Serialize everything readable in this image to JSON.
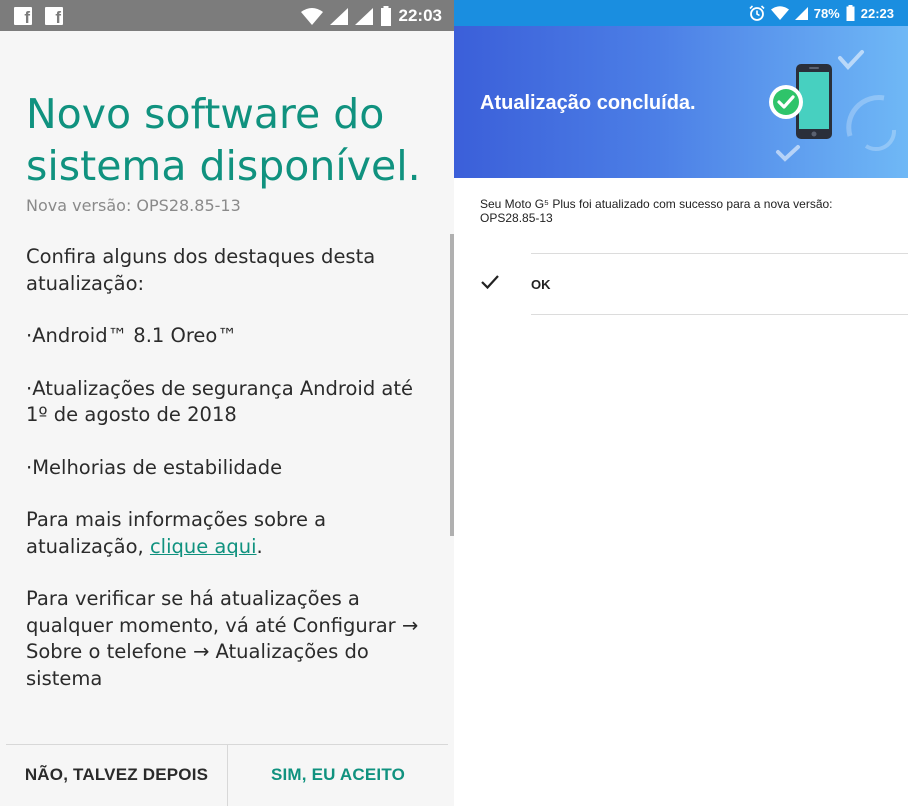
{
  "left_screen": {
    "status_bar": {
      "time": "22:03",
      "icons": [
        "facebook-icon",
        "facebook-icon",
        "wifi-icon",
        "signal-icon",
        "signal-icon",
        "battery-icon"
      ]
    },
    "title": "Novo software do sistema disponível.",
    "version": "Nova versão: OPS28.85-13",
    "intro": "Confira alguns dos destaques desta atualização:",
    "highlights": [
      "·Android™ 8.1 Oreo™",
      "·Atualizações de segurança Android até 1º de agosto de 2018",
      "·Melhorias de estabilidade"
    ],
    "more_info_prefix": "Para mais informações sobre a atualização, ",
    "more_info_link": "clique aqui",
    "more_info_suffix": ".",
    "check_updates": "Para verificar se há atualizações a qualquer momento, vá até Configurar → Sobre o telefone → Atualizações do sistema",
    "buttons": {
      "decline": "NÃO, TALVEZ DEPOIS",
      "accept": "SIM, EU ACEITO"
    },
    "colors": {
      "accent": "#10927f",
      "status_bar": "#7c7c7c"
    }
  },
  "right_screen": {
    "status_bar": {
      "time": "22:23",
      "battery": "78%",
      "icons": [
        "alarm-icon",
        "wifi-icon",
        "signal-icon",
        "battery-icon"
      ]
    },
    "banner_title": "Atualização concluída.",
    "message": "Seu Moto G⁵ Plus foi atualizado com sucesso para a nova versão: OPS28.85-13",
    "ok_label": "OK",
    "colors": {
      "banner_start": "#3b5fd9",
      "banner_end": "#6fb8f6",
      "status_bar": "#1a8ee0"
    }
  }
}
